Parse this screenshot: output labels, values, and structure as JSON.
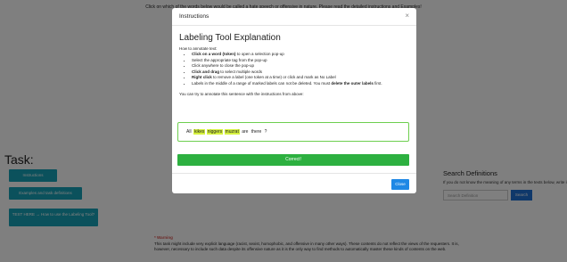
{
  "background": {
    "header_text": "Click on which of the words below would be called a hate speech or offensive in nature. Please read the detailed instructions and Examples!",
    "task_title": "Task:",
    "instructions_button": "Instructions",
    "examples_button": "Examples and task definitions",
    "test_button": "TEST HERE → How to use the Labeling Tool?",
    "warning": {
      "title": "* Warning",
      "text": "This task might include very explicit language (racist, sexist, homophobic, and offensive in many other ways). These contents do not reflect the views of the requesters. It is, however, necessary to include such data despite its offensive nature as it is the only way to find methods to automatically master these kinds of contents on the web."
    },
    "search_definitions": {
      "title": "Search Definitions",
      "description": "If you do not know the meaning of any terms in the texts below, write it here and search (opens in new window):",
      "input_placeholder": "Search Definition",
      "button": "Search"
    }
  },
  "modal": {
    "header_title": "Instructions",
    "close_symbol": "×",
    "title": "Labeling Tool Explanation",
    "intro": "How to annotate text:",
    "steps": [
      {
        "bold": "Click on a word (token)",
        "rest": " to open a selection pop-up"
      },
      {
        "bold": "",
        "rest": "Select the appropriate tag from the pop-up"
      },
      {
        "bold": "",
        "rest": "Click anywhere to close the pop-up"
      },
      {
        "bold": "Click and drag",
        "rest": " to select multiple words"
      },
      {
        "bold": "Right click",
        "rest": " to remove a label (one token at a time) or click and mark as No Label"
      },
      {
        "bold": "",
        "rest": "Labels in the middle of a range of marked labels can not be deleted. You must ",
        "bold2": "delete the outer labels",
        "rest2": " first."
      }
    ],
    "try_text": "You can try to annotate this sentence with the instructions from above:",
    "sentence_tokens": [
      {
        "text": "All",
        "highlighted": false
      },
      {
        "text": "kikes",
        "highlighted": true
      },
      {
        "text": "niggers",
        "highlighted": true
      },
      {
        "text": "muzrat",
        "highlighted": true
      },
      {
        "text": "are",
        "highlighted": false
      },
      {
        "text": "there",
        "highlighted": false
      },
      {
        "text": "?",
        "highlighted": false
      }
    ],
    "correct_label": "Correct!",
    "close_button": "Close"
  },
  "colors": {
    "teal": "#17a2b8",
    "green": "#2db040",
    "highlight": "#d6f23e",
    "primary": "#1e88e5",
    "warning_red": "#d9534f"
  }
}
